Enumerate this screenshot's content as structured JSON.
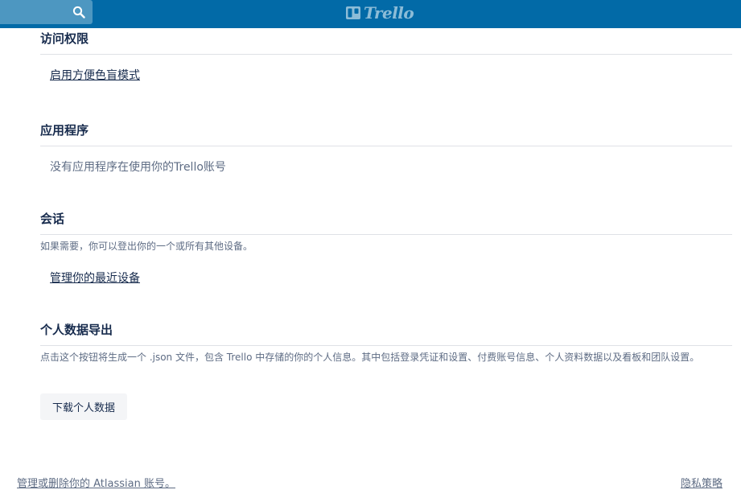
{
  "header": {
    "logo_text": "Trello",
    "search_icon": "search-icon",
    "logo_icon": "trello-board-icon",
    "bg_color": "#026aa7"
  },
  "sections": {
    "access": {
      "title": "访问权限",
      "colorblind_link": "启用方便色盲模式"
    },
    "apps": {
      "title": "应用程序",
      "empty_text": "没有应用程序在使用你的Trello账号"
    },
    "sessions": {
      "title": "会话",
      "description": "如果需要，你可以登出你的一个或所有其他设备。",
      "manage_link": "管理你的最近设备"
    },
    "data_export": {
      "title": "个人数据导出",
      "description": "点击这个按钮将生成一个 .json 文件，包含 Trello 中存储的你的个人信息。其中包括登录凭证和设置、付费账号信息、个人资料数据以及看板和团队设置。",
      "download_button": "下载个人数据"
    }
  },
  "footer": {
    "atlassian_link": "管理或删除你的 Atlassian 账号。",
    "privacy_link": "隐私策略"
  }
}
